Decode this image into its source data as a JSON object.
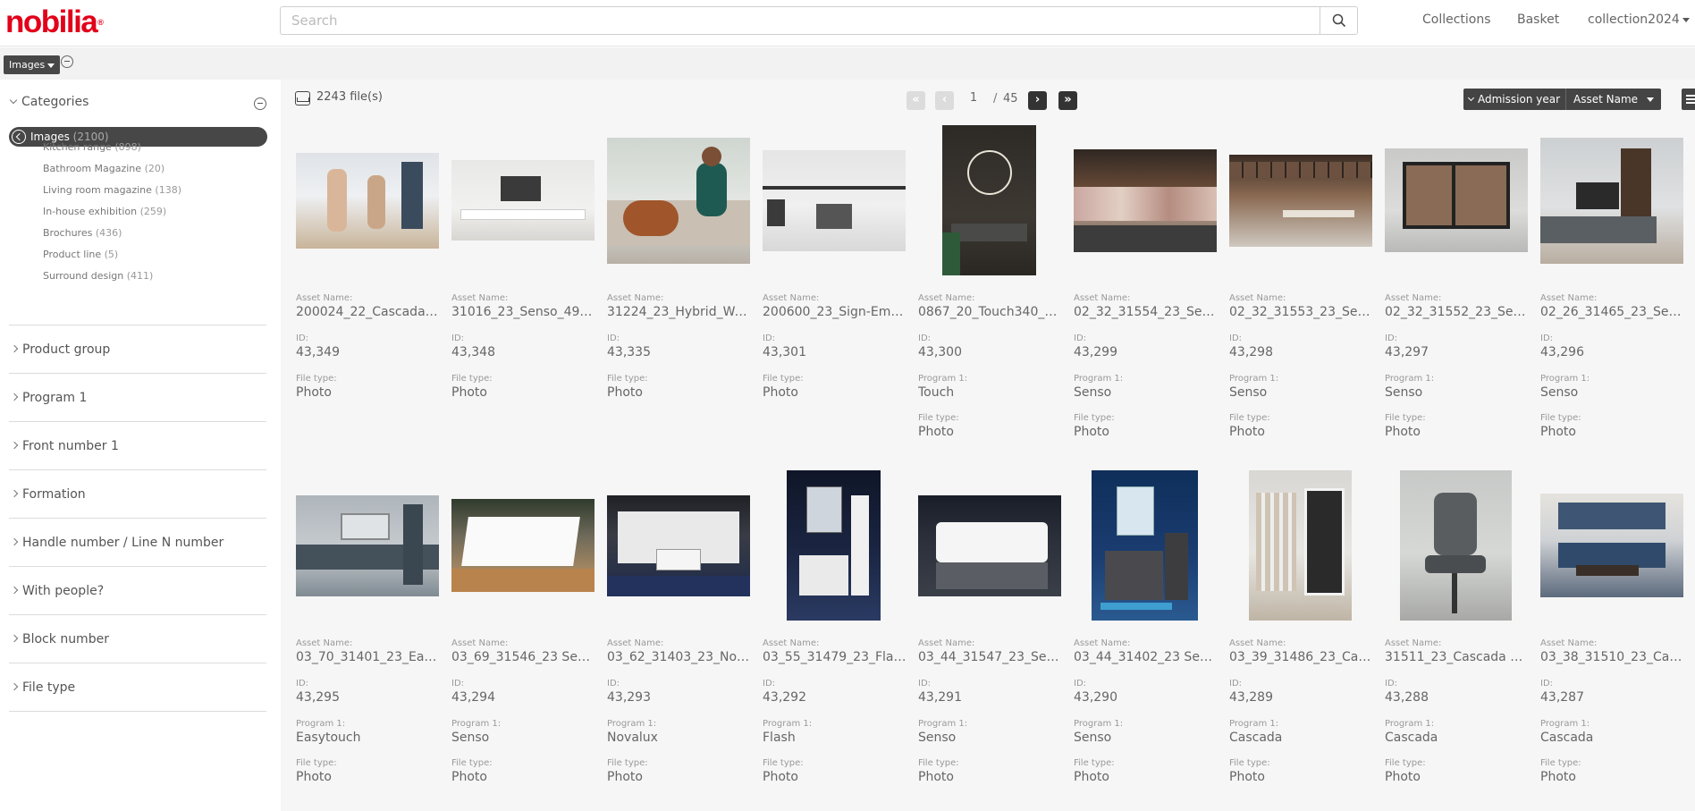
{
  "header": {
    "logo": "nobilia",
    "search_placeholder": "Search",
    "nav": {
      "collections": "Collections",
      "basket": "Basket",
      "collection": "collection2024"
    }
  },
  "subbar": {
    "images_button": "Images"
  },
  "sidebar": {
    "categories_title": "Categories",
    "active": {
      "label": "Images",
      "count": "(2100)"
    },
    "subcategories": [
      {
        "label": "Kitchen range",
        "count": "(898)"
      },
      {
        "label": "Bathroom Magazine",
        "count": "(20)"
      },
      {
        "label": "Living room magazine",
        "count": "(138)"
      },
      {
        "label": "In-house exhibition",
        "count": "(259)"
      },
      {
        "label": "Brochures",
        "count": "(436)"
      },
      {
        "label": "Product line",
        "count": "(5)"
      },
      {
        "label": "Surround design",
        "count": "(411)"
      }
    ],
    "facets": [
      "Product group",
      "Program 1",
      "Front number 1",
      "Formation",
      "Handle number / Line N number",
      "With people?",
      "Block number",
      "File type"
    ]
  },
  "toolbar": {
    "files_count": "2243 file(s)",
    "page_current": "1",
    "page_separator": "/",
    "page_total": "45",
    "sort_admission": "Admission year",
    "sort_name": "Asset Name",
    "view_label": "M",
    "first_icon": "«",
    "prev_icon": "‹",
    "next_icon": "›",
    "last_icon": "»"
  },
  "labels": {
    "asset_name": "Asset Name:",
    "id": "ID:",
    "program": "Program 1:",
    "file_type": "File type:"
  },
  "assets": [
    {
      "name": "200024_22_Cascada_7...",
      "id": "43,349",
      "program": "",
      "file_type": "Photo"
    },
    {
      "name": "31016_23_Senso_490_...",
      "id": "43,348",
      "program": "",
      "file_type": "Photo"
    },
    {
      "name": "31224_23_Hybrid_Woh...",
      "id": "43,335",
      "program": "",
      "file_type": "Photo"
    },
    {
      "name": "200600_23_Sign-Emoti...",
      "id": "43,301",
      "program": "",
      "file_type": "Photo"
    },
    {
      "name": "0867_20_Touch340_R1...",
      "id": "43,300",
      "program": "Touch",
      "file_type": "Photo"
    },
    {
      "name": "02_32_31554_23_Sens...",
      "id": "43,299",
      "program": "Senso",
      "file_type": "Photo"
    },
    {
      "name": "02_32_31553_23_Sens...",
      "id": "43,298",
      "program": "Senso",
      "file_type": "Photo"
    },
    {
      "name": "02_32_31552_23_Sens...",
      "id": "43,297",
      "program": "Senso",
      "file_type": "Photo"
    },
    {
      "name": "02_26_31465_23_Sens...",
      "id": "43,296",
      "program": "Senso",
      "file_type": "Photo"
    },
    {
      "name": "03_70_31401_23_Easyt...",
      "id": "43,295",
      "program": "Easytouch",
      "file_type": "Photo"
    },
    {
      "name": "03_69_31546_23 Sens...",
      "id": "43,294",
      "program": "Senso",
      "file_type": "Photo"
    },
    {
      "name": "03_62_31403_23_Nova...",
      "id": "43,293",
      "program": "Novalux",
      "file_type": "Photo"
    },
    {
      "name": "03_55_31479_23_Flash...",
      "id": "43,292",
      "program": "Flash",
      "file_type": "Photo"
    },
    {
      "name": "03_44_31547_23_Sens...",
      "id": "43,291",
      "program": "Senso",
      "file_type": "Photo"
    },
    {
      "name": "03_44_31402_23 Sens...",
      "id": "43,290",
      "program": "Senso",
      "file_type": "Photo"
    },
    {
      "name": "03_39_31486_23_Casc...",
      "id": "43,289",
      "program": "Cascada",
      "file_type": "Photo"
    },
    {
      "name": "31511_23_Cascada 77...",
      "id": "43,288",
      "program": "Cascada",
      "file_type": "Photo"
    },
    {
      "name": "03_38_31510_23_Casc...",
      "id": "43,287",
      "program": "Cascada",
      "file_type": "Photo"
    }
  ]
}
